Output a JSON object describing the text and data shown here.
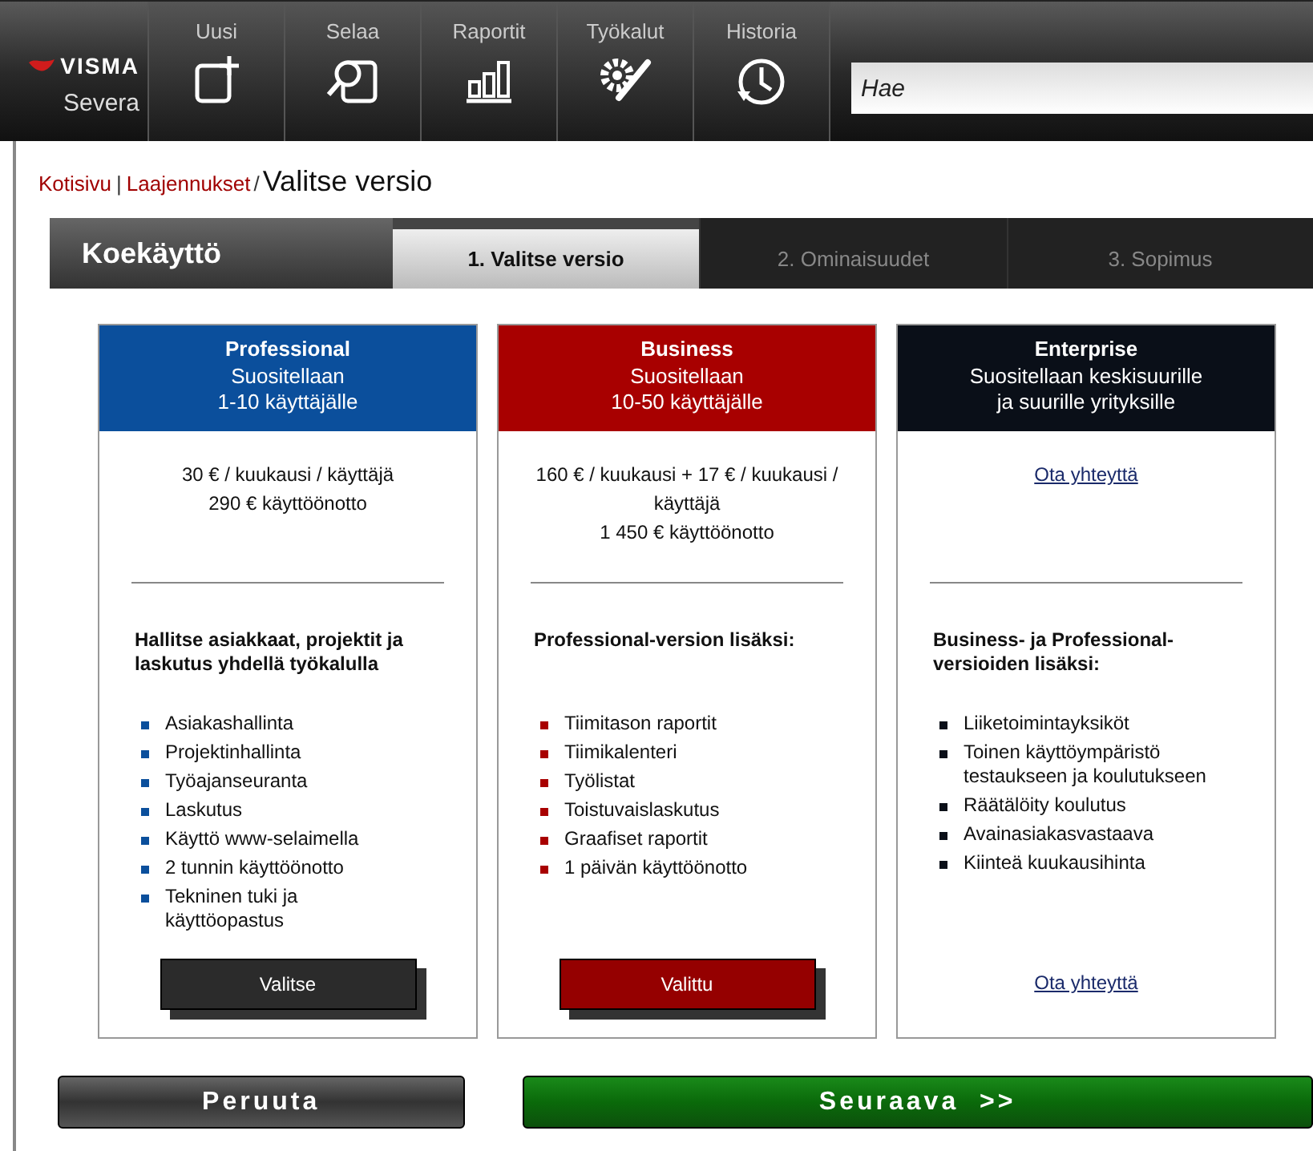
{
  "brand": {
    "logo": "VISMA",
    "product": "Severa"
  },
  "nav": [
    {
      "label": "Uusi",
      "kind": "new"
    },
    {
      "label": "Selaa",
      "kind": "browse"
    },
    {
      "label": "Raportit",
      "kind": "reports"
    },
    {
      "label": "Työkalut",
      "kind": "tools"
    },
    {
      "label": "Historia",
      "kind": "history"
    }
  ],
  "search": {
    "placeholder": "Hae"
  },
  "breadcrumb": {
    "links": [
      "Kotisivu",
      "Laajennukset"
    ],
    "link_separator": "|",
    "separator": "/",
    "current": "Valitse versio"
  },
  "wizard": {
    "title": "Koekäyttö",
    "steps": [
      {
        "label": "1. Valitse versio",
        "selected": true
      },
      {
        "label": "2. Ominaisuudet",
        "selected": false
      },
      {
        "label": "3. Sopimus",
        "selected": false
      }
    ]
  },
  "plans": [
    {
      "name": "Professional",
      "color": "#0b4f9c",
      "subtitle": [
        "Suositellaan",
        "1-10 käyttäjälle"
      ],
      "price": {
        "kind": "text",
        "lines": [
          "30 € / kuukausi / käyttäjä",
          "290 € käyttöönotto"
        ]
      },
      "heading": "Hallitse asiakkaat, projektit ja laskutus yhdellä työkalulla",
      "features": [
        "Asiakashallinta",
        "Projektinhallinta",
        "Työajanseuranta",
        "Laskutus",
        "Käyttö www-selaimella",
        "2 tunnin käyttöönotto",
        "Tekninen tuki ja käyttöopastus"
      ],
      "action": {
        "kind": "button",
        "label": "Valitse",
        "selected": false
      }
    },
    {
      "name": "Business",
      "color": "#a80000",
      "subtitle": [
        "Suositellaan",
        "10-50 käyttäjälle"
      ],
      "price": {
        "kind": "text",
        "lines": [
          "160 € / kuukausi + 17 € / kuukausi / käyttäjä",
          "1 450 € käyttöönotto"
        ]
      },
      "heading": "Professional-version lisäksi:",
      "features": [
        "Tiimitason raportit",
        "Tiimikalenteri",
        "Työlistat",
        "Toistuvaislaskutus",
        "Graafiset raportit",
        "1 päivän käyttöönotto"
      ],
      "action": {
        "kind": "button",
        "label": "Valittu",
        "selected": true
      }
    },
    {
      "name": "Enterprise",
      "color": "#0a0f18",
      "subtitle": [
        "Suositellaan keskisuurille",
        "ja suurille yrityksille"
      ],
      "price": {
        "kind": "link",
        "text": "Ota yhteyttä"
      },
      "heading": "Business- ja Professional-versioiden lisäksi:",
      "features": [
        "Liiketoimintayksiköt",
        "Toinen käyttöympäristö testaukseen ja koulutukseen",
        "Räätälöity koulutus",
        "Avainasiakasvastaava",
        "Kiinteä kuukausihinta"
      ],
      "action": {
        "kind": "link",
        "text": "Ota yhteyttä"
      }
    }
  ],
  "footer": {
    "cancel": "Peruuta",
    "next": "Seuraava  >>"
  }
}
